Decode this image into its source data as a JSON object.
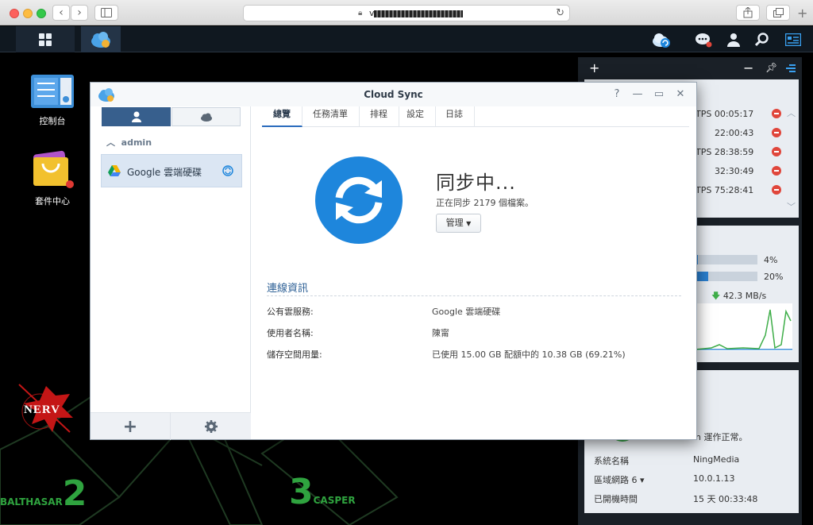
{
  "browser": {
    "url_visible": "v",
    "back_icon": "chevron-left-icon",
    "forward_icon": "chevron-right-icon"
  },
  "desktop": {
    "icons": [
      {
        "label": "控制台"
      },
      {
        "label": "套件中心"
      }
    ],
    "decor": {
      "nerv": "NERV",
      "balthasar_number": "2",
      "balthasar_name": "BALTHASAR",
      "casper_number": "3",
      "casper_name": "CASPER"
    }
  },
  "widgets": {
    "connections": [
      {
        "value": "TPS 00:05:17"
      },
      {
        "value": "22:00:43"
      },
      {
        "value": "TPS 28:38:59"
      },
      {
        "value": "32:30:49"
      },
      {
        "value": "TPS 75:28:41"
      }
    ],
    "resource": {
      "cpu_percent": "4%",
      "ram_percent": "20%",
      "cpu_fraction": 0.04,
      "ram_fraction": 0.2,
      "download_speed": "42.3 MB/s"
    },
    "system": {
      "status": "n 運作正常。",
      "rows": [
        {
          "label": "系統名稱",
          "value": "NingMedia"
        },
        {
          "label": "區域網路 6 ▾",
          "value": "10.0.1.13"
        },
        {
          "label": "已開機時間",
          "value": "15 天 00:33:48"
        }
      ]
    }
  },
  "window": {
    "title": "Cloud Sync",
    "help": "?",
    "account_header": "admin",
    "task_label": "Google 雲端硬碟",
    "tabs": [
      "總覽",
      "任務清單",
      "排程",
      "設定",
      "日誌"
    ],
    "status_title": "同步中...",
    "status_sub": "正在同步 2179 個檔案。",
    "manage_label": "管理",
    "section_title": "連線資訊",
    "info": [
      {
        "label": "公有雲服務:",
        "value": "Google 雲端硬碟"
      },
      {
        "label": "使用者名稱:",
        "value": "陳甯"
      },
      {
        "label": "儲存空間用量:",
        "value": "已使用 15.00 GB 配額中的 10.38 GB (69.21%)"
      }
    ]
  },
  "colors": {
    "sync_blue": "#1e86dc",
    "header_blue": "#2c5f95",
    "segment_active": "#375f8d",
    "minus_red": "#e0463b",
    "graph_green": "#3fae49"
  }
}
